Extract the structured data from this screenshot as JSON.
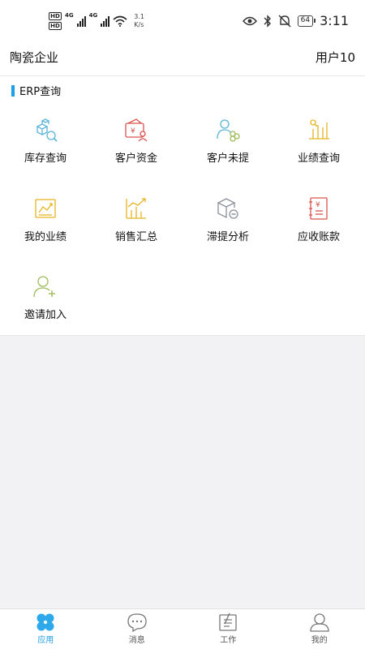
{
  "status_bar": {
    "hd1": "HD",
    "hd2": "HD",
    "net1": "4G",
    "net2": "4G",
    "speed": "3.1\nK/s",
    "battery": "64",
    "time": "3:11"
  },
  "header": {
    "company": "陶瓷企业",
    "user": "用户10"
  },
  "section": {
    "title": "ERP查询"
  },
  "tiles": [
    {
      "label": "库存查询",
      "icon": "inventory-boxes-icon"
    },
    {
      "label": "客户资金",
      "icon": "customer-funds-icon"
    },
    {
      "label": "客户未提",
      "icon": "customer-pending-icon"
    },
    {
      "label": "业绩查询",
      "icon": "performance-query-icon"
    },
    {
      "label": "我的业绩",
      "icon": "my-performance-icon"
    },
    {
      "label": "销售汇总",
      "icon": "sales-summary-icon"
    },
    {
      "label": "滞提分析",
      "icon": "delayed-pickup-icon"
    },
    {
      "label": "应收账款",
      "icon": "receivables-icon"
    },
    {
      "label": "邀请加入",
      "icon": "invite-user-icon"
    }
  ],
  "tabbar": {
    "items": [
      {
        "label": "应用",
        "icon": "apps-icon",
        "active": true
      },
      {
        "label": "消息",
        "icon": "message-icon",
        "active": false
      },
      {
        "label": "工作",
        "icon": "work-icon",
        "active": false
      },
      {
        "label": "我的",
        "icon": "profile-icon",
        "active": false
      }
    ]
  },
  "colors": {
    "accent": "#1ea0e6",
    "icon_blue": "#5ab4d6",
    "icon_red": "#d9534f",
    "icon_yellow": "#e6b422",
    "icon_green": "#9dbb5a",
    "icon_gray": "#8a9099"
  }
}
